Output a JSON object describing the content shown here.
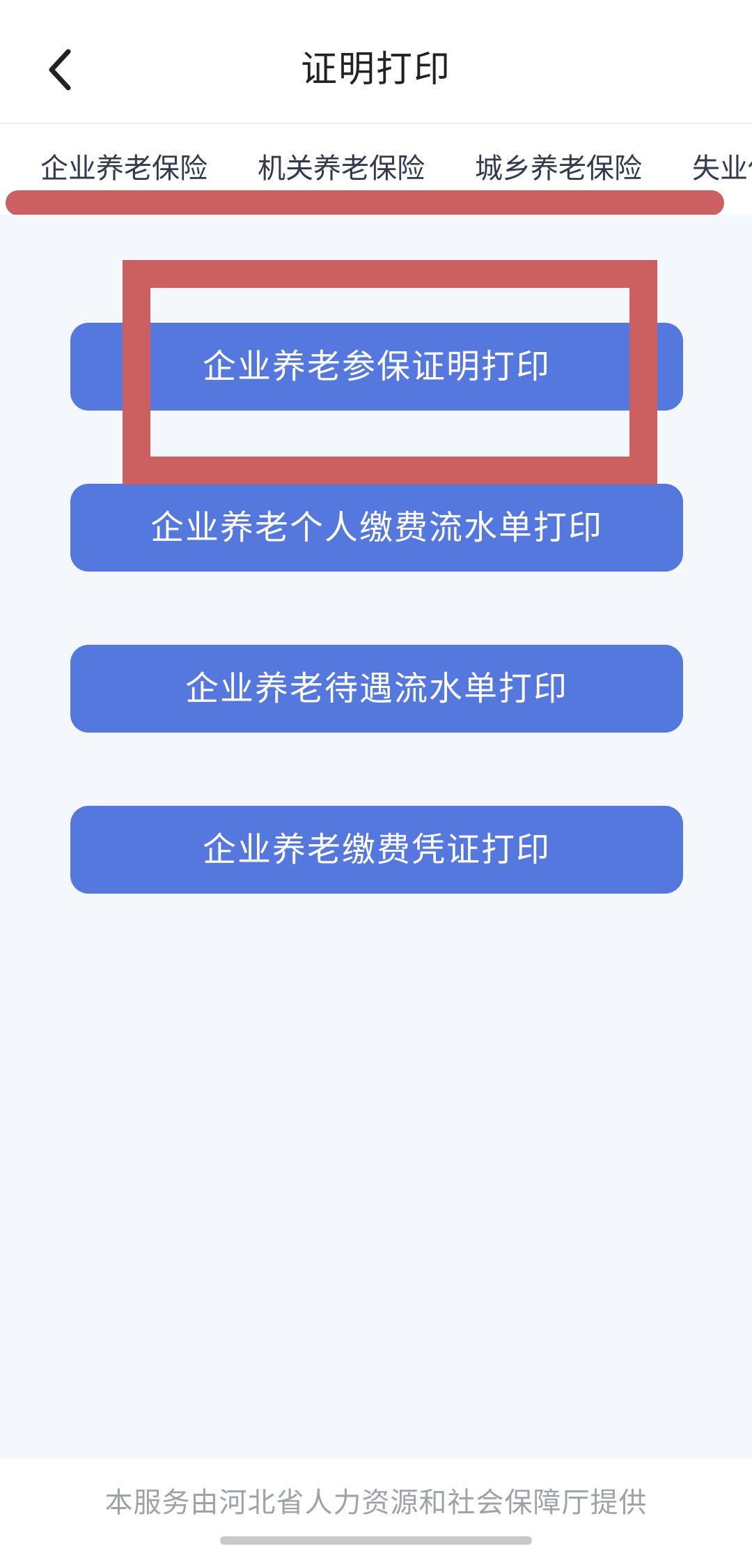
{
  "header": {
    "title": "证明打印",
    "back_icon": "chevron-left-icon"
  },
  "tabs": [
    {
      "label": "企业养老保险",
      "active": true
    },
    {
      "label": "机关养老保险",
      "active": false
    },
    {
      "label": "城乡养老保险",
      "active": false
    },
    {
      "label": "失业保险",
      "active": false
    }
  ],
  "actions": [
    {
      "label": "企业养老参保证明打印"
    },
    {
      "label": "企业养老个人缴费流水单打印"
    },
    {
      "label": "企业养老待遇流水单打印"
    },
    {
      "label": "企业养老缴费凭证打印"
    }
  ],
  "footer": {
    "text": "本服务由河北省人力资源和社会保障厅提供"
  },
  "colors": {
    "accent": "#5478dd",
    "annotation": "#cc5f5f",
    "background": "#f4f7fb"
  }
}
